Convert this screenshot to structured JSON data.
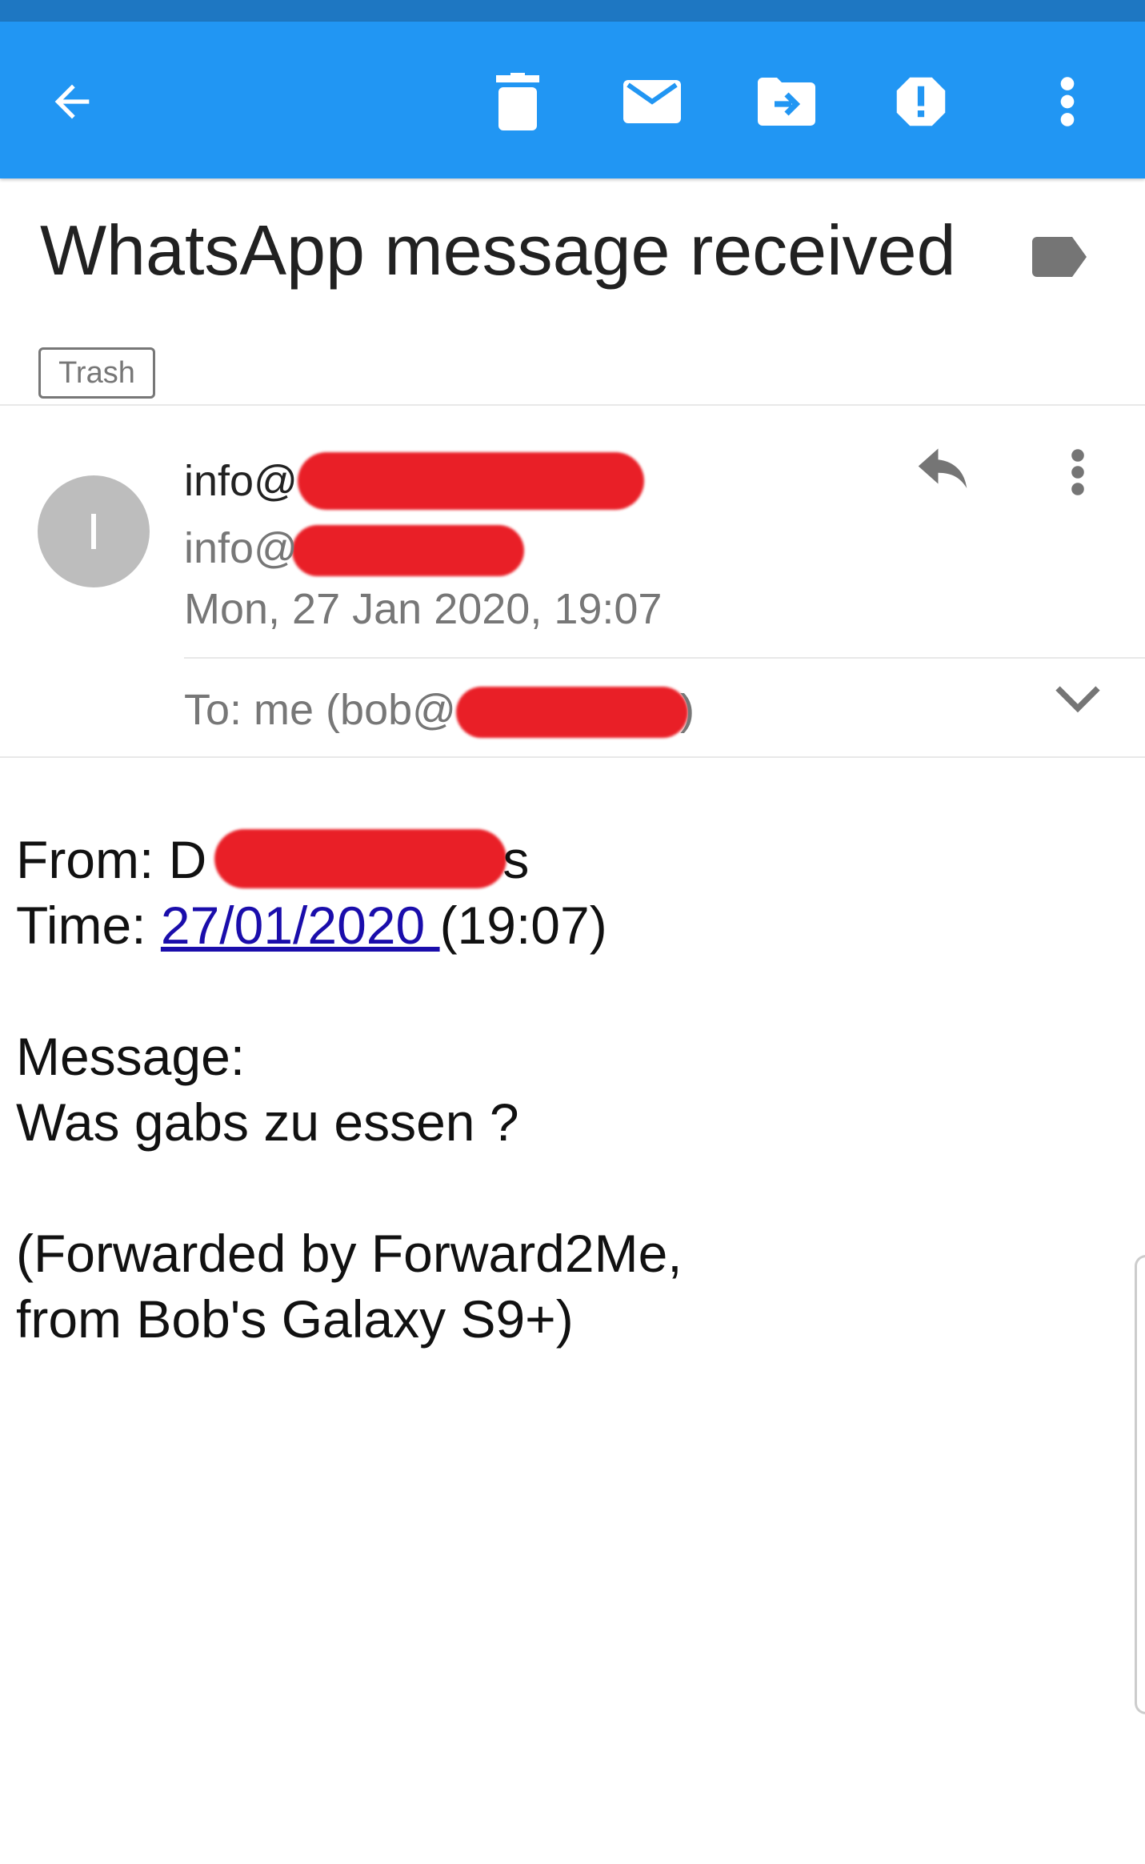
{
  "toolbar": {
    "icons": [
      "arrow-back-icon",
      "delete-icon",
      "mark-unread-icon",
      "move-to-folder-icon",
      "report-spam-icon",
      "more-vert-icon"
    ],
    "color": "#2196f3"
  },
  "email": {
    "subject": "WhatsApp message received",
    "folder_chip": "Trash",
    "avatar_letter": "I",
    "sender_name": "info@",
    "sender_email": "info@",
    "date": "Mon, 27 Jan 2020, 19:07",
    "to_prefix": "To: me (bob@",
    "to_suffix": ")"
  },
  "body": {
    "from_label": "From: D",
    "from_suffix": "s",
    "time_label": "Time: ",
    "time_link": "27/01/2020 ",
    "time_suffix": "(19:07)",
    "message_label": "Message:",
    "message_text": "Was gabs zu essen ?",
    "footer_line1": "(Forwarded by Forward2Me,",
    "footer_line2": "from Bob's Galaxy S9+)"
  },
  "colors": {
    "redaction": "#e8141c",
    "link": "#1a0dab"
  }
}
